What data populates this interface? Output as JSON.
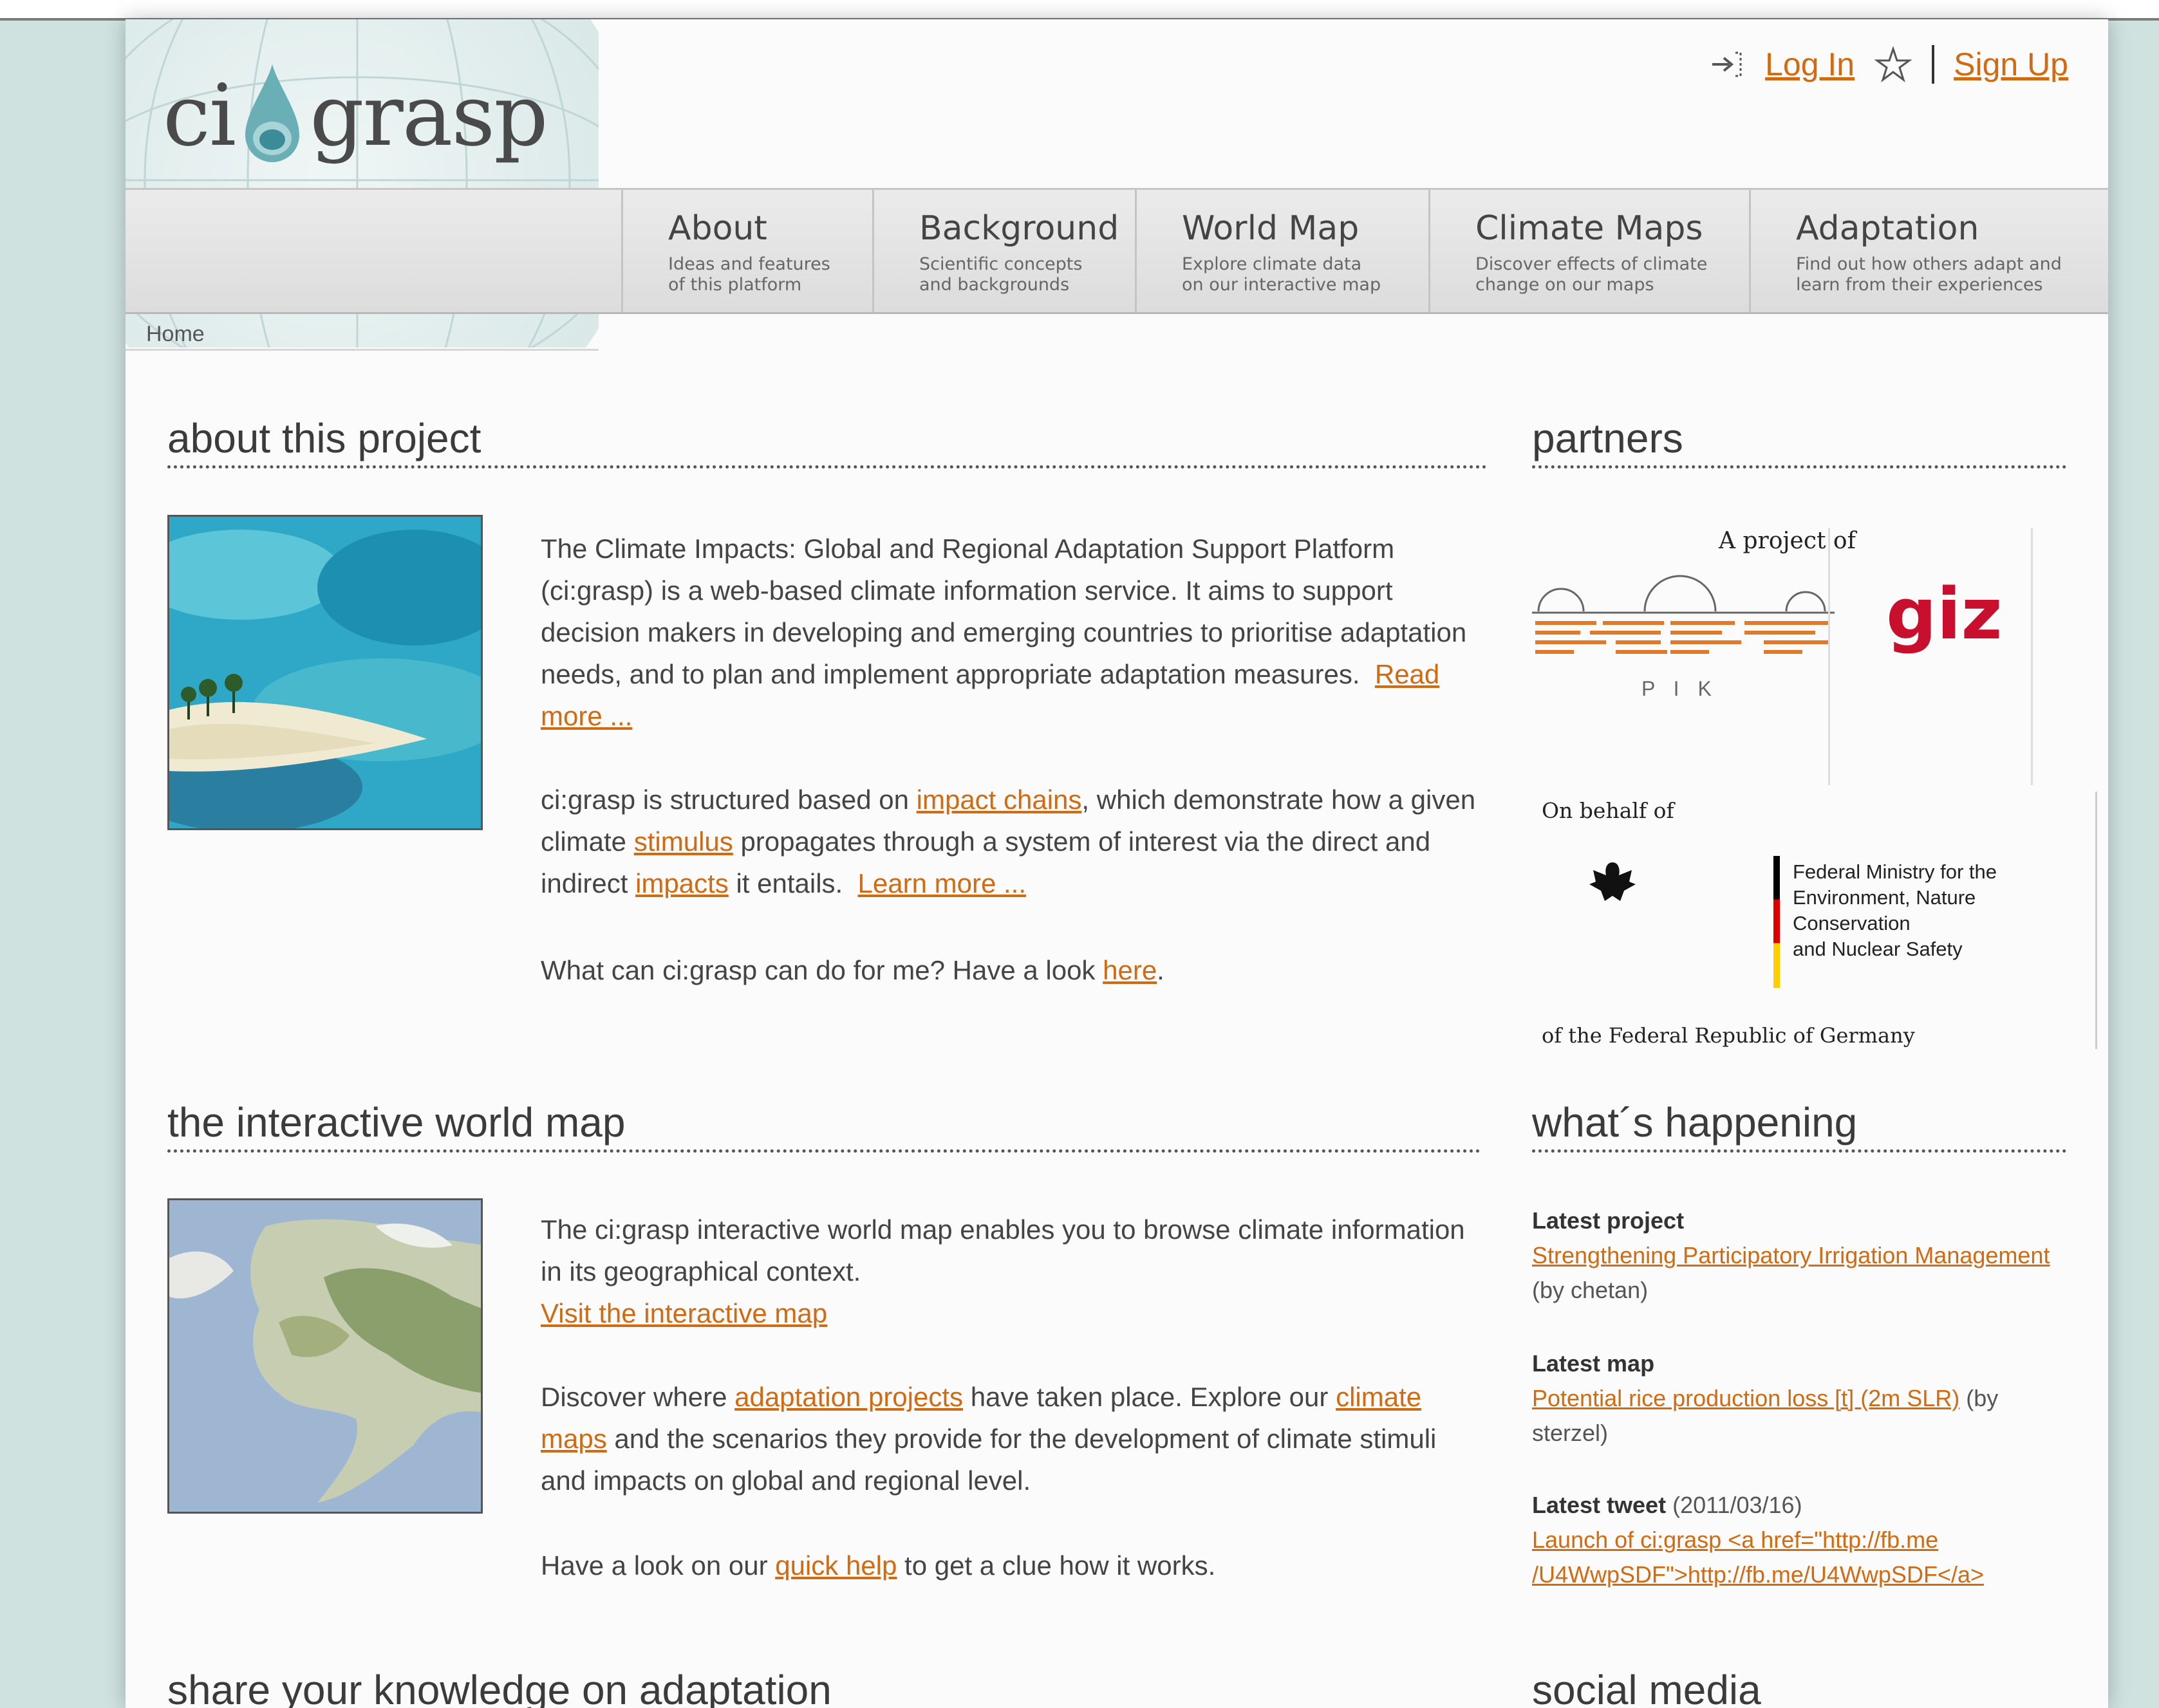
{
  "header": {
    "logo_left": "ci",
    "logo_right": "grasp",
    "login_label": "Log In",
    "signup_label": "Sign Up"
  },
  "nav": [
    {
      "title": "About",
      "desc": "Ideas and features\nof this platform"
    },
    {
      "title": "Background",
      "desc": "Scientific concepts\nand backgrounds"
    },
    {
      "title": "World Map",
      "desc": "Explore climate data\non our interactive map"
    },
    {
      "title": "Climate Maps",
      "desc": "Discover effects of climate\nchange on our maps"
    },
    {
      "title": "Adaptation",
      "desc": "Find out how others adapt and\nlearn from their experiences"
    }
  ],
  "breadcrumb": "Home",
  "about": {
    "heading": "about this project",
    "p1": "The Climate Impacts: Global and Regional Adaptation Support Platform (ci:grasp) is a web-based climate information service. It aims to support decision makers in developing and emerging countries to prioritise adaptation needs, and to plan and implement appropriate adaptation measures.",
    "p1_link": "Read more ...",
    "p2_a": "ci:grasp is structured based on",
    "p2_link1": "impact chains",
    "p2_b": ", which demonstrate how a given climate",
    "p2_link2": "stimulus",
    "p2_c": "propagates through a system of interest via the direct and indirect",
    "p2_link3": "impacts",
    "p2_d": "it entails.",
    "p2_link4": "Learn more ...",
    "p3_a": "What can ci:grasp can do for me? Have a look",
    "p3_link": "here",
    "p3_b": "."
  },
  "partners": {
    "heading": "partners",
    "project_of": "A project of",
    "pik_label": "P I K",
    "giz_label": "giz",
    "on_behalf": "On behalf of",
    "ministry_line1": "Federal Ministry for the",
    "ministry_line2": "Environment, Nature Conservation",
    "ministry_line3": "and Nuclear Safety",
    "republic": "of the Federal Republic of Germany"
  },
  "worldmap": {
    "heading": "the interactive world map",
    "p1": "The ci:grasp interactive world map enables you to browse climate information in its geographical context.",
    "p1_link": "Visit the interactive map",
    "p2_a": "Discover where",
    "p2_link1": "adaptation projects",
    "p2_b": "have taken place. Explore our",
    "p2_link2": "climate maps",
    "p2_c": "and the scenarios they provide for the development of climate stimuli and impacts on global and regional level.",
    "p3_a": "Have a look on our",
    "p3_link": "quick help",
    "p3_b": "to get a clue how it works."
  },
  "happening": {
    "heading": "what´s happening",
    "project_label": "Latest project",
    "project_link": "Strengthening Participatory Irrigation Management",
    "project_by": "(by chetan)",
    "map_label": "Latest map",
    "map_link": "Potential rice production loss [t] (2m SLR)",
    "map_by": "(by sterzel)",
    "tweet_label": "Latest tweet",
    "tweet_date": "(2011/03/16)",
    "tweet_link": "Launch of ci:grasp <a href=\"http://fb.me /U4WwpSDF\">http://fb.me/U4WwpSDF</a>"
  },
  "bottom": {
    "share_heading": "share your knowledge on adaptation",
    "social_heading": "social media"
  },
  "colors": {
    "link": "#d06b12",
    "giz_red": "#c8102e",
    "pik_orange": "#e07a2a"
  }
}
